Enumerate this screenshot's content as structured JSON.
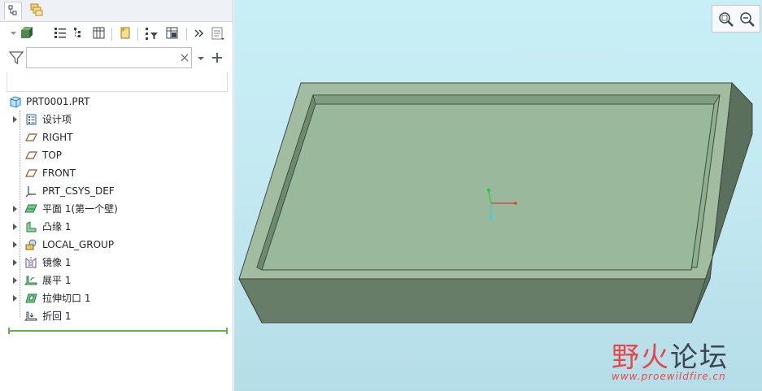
{
  "search": {
    "value": "",
    "placeholder": ""
  },
  "model_tree": {
    "root": "PRT0001.PRT",
    "items": [
      {
        "label": "设计项",
        "expandable": true,
        "icon": "design-items-icon"
      },
      {
        "label": "RIGHT",
        "expandable": false,
        "icon": "datum-plane-icon"
      },
      {
        "label": "TOP",
        "expandable": false,
        "icon": "datum-plane-icon"
      },
      {
        "label": "FRONT",
        "expandable": false,
        "icon": "datum-plane-icon"
      },
      {
        "label": "PRT_CSYS_DEF",
        "expandable": false,
        "icon": "csys-icon"
      },
      {
        "label": "平面 1(第一个壁)",
        "expandable": true,
        "icon": "planar-wall-icon"
      },
      {
        "label": "凸缘 1",
        "expandable": true,
        "icon": "flange-icon"
      },
      {
        "label": "LOCAL_GROUP",
        "expandable": true,
        "icon": "group-icon"
      },
      {
        "label": "镜像 1",
        "expandable": true,
        "icon": "mirror-icon"
      },
      {
        "label": "展平 1",
        "expandable": true,
        "icon": "unbend-icon"
      },
      {
        "label": "拉伸切口 1",
        "expandable": true,
        "icon": "extrude-cut-icon"
      },
      {
        "label": "折回 1",
        "expandable": false,
        "icon": "bend-back-icon"
      }
    ]
  },
  "watermark": {
    "title_a": "野",
    "title_b": "火",
    "title_c": "论坛",
    "url": "www.proewildfire.cn"
  },
  "colors": {
    "viewport_bg": "#c4e9f2",
    "part_top": "#9fb9a0",
    "part_side": "#627764",
    "part_front": "#748f75",
    "insert_line": "#5fb548",
    "watermark_red": "#e8474a"
  }
}
